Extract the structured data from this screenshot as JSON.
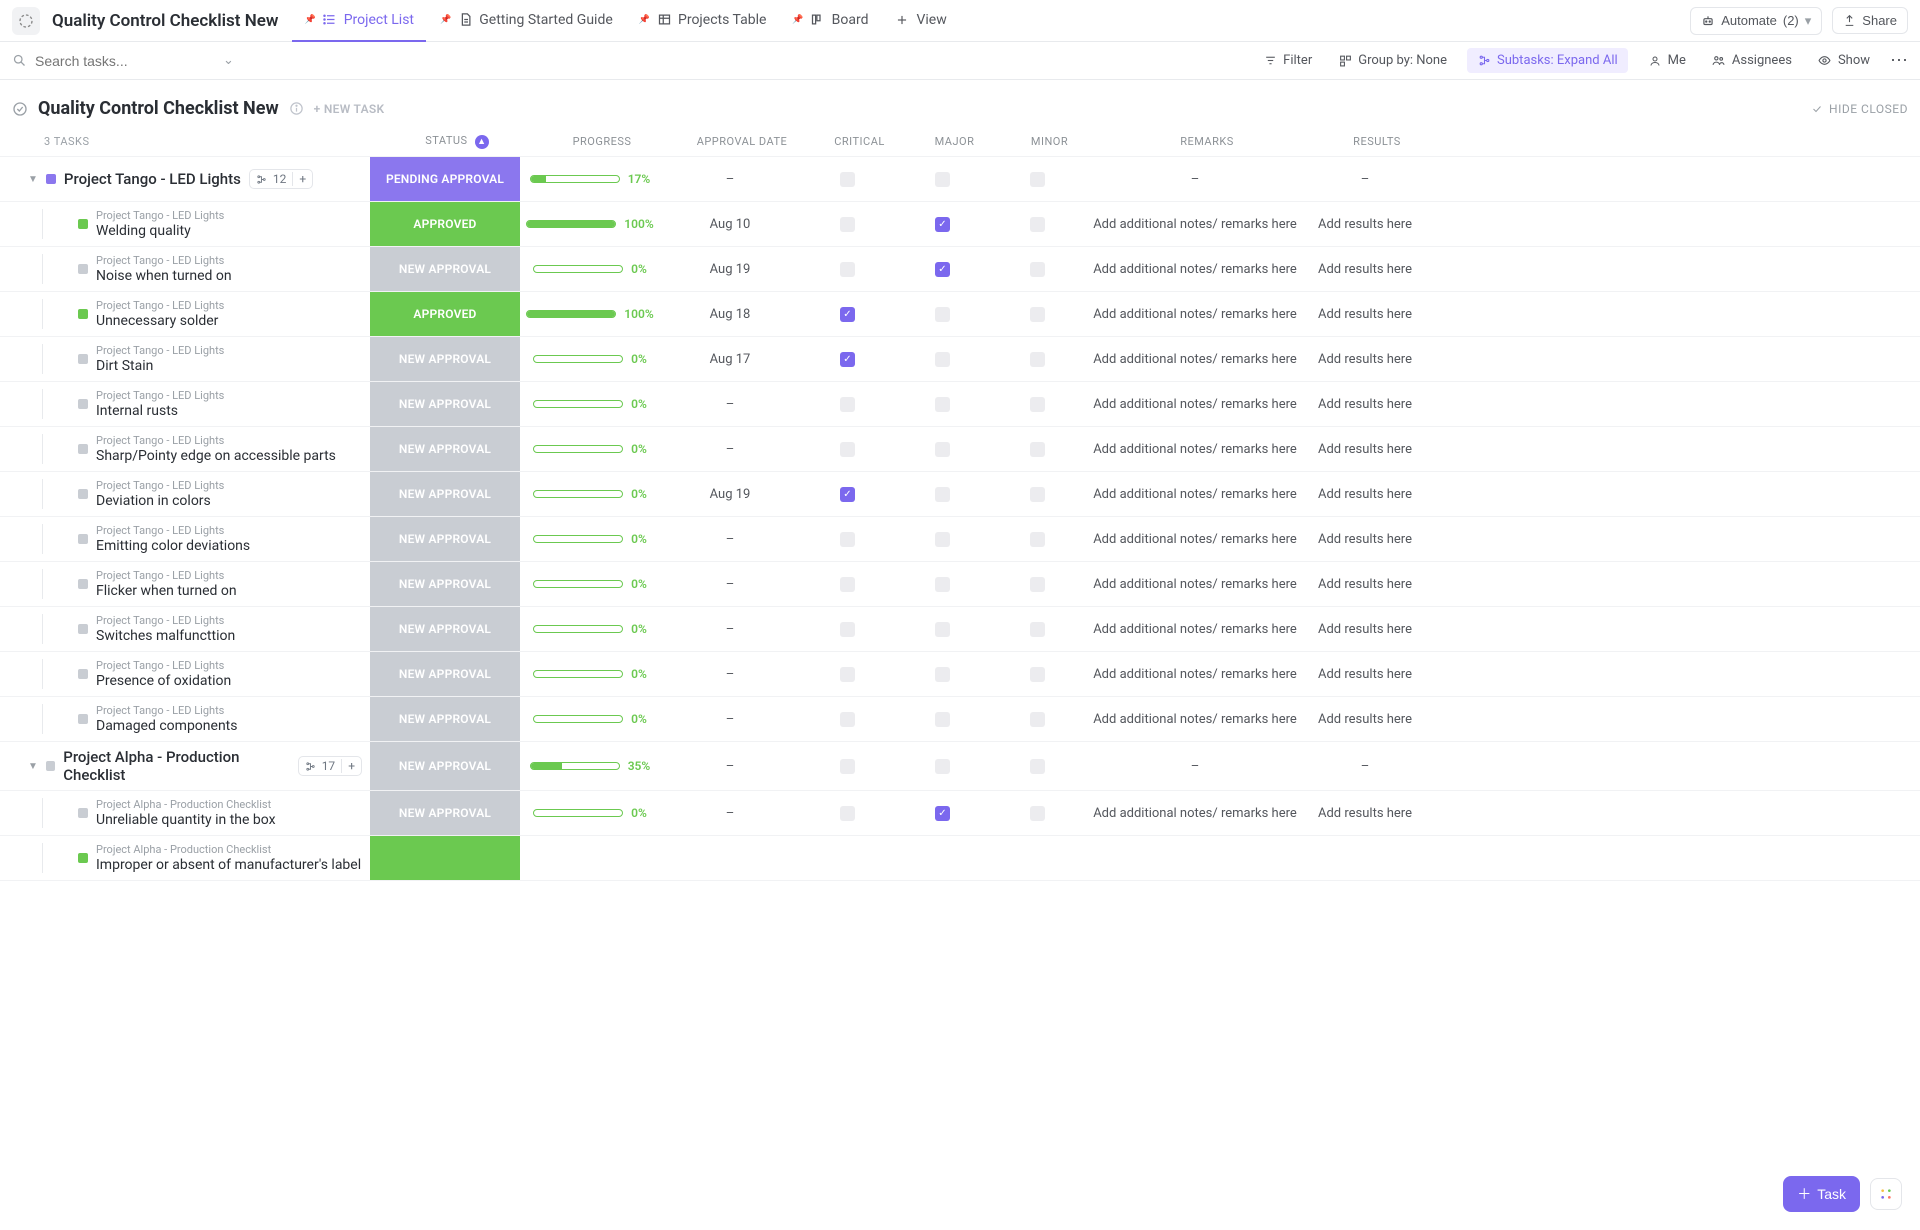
{
  "header": {
    "title": "Quality Control Checklist New",
    "tabs": [
      {
        "label": "Project List",
        "active": true,
        "icon": "list"
      },
      {
        "label": "Getting Started Guide",
        "active": false,
        "icon": "doc"
      },
      {
        "label": "Projects Table",
        "active": false,
        "icon": "table"
      },
      {
        "label": "Board",
        "active": false,
        "icon": "board"
      },
      {
        "label": "View",
        "active": false,
        "icon": "plus",
        "noPin": true
      }
    ],
    "automate": {
      "label": "Automate",
      "count": "(2)"
    },
    "share": "Share"
  },
  "filterbar": {
    "search_placeholder": "Search tasks...",
    "filter": "Filter",
    "groupby": "Group by: None",
    "subtasks": "Subtasks: Expand All",
    "me": "Me",
    "assignees": "Assignees",
    "show": "Show"
  },
  "section": {
    "title": "Quality Control Checklist New",
    "new_task": "+ NEW TASK",
    "hide_closed": "HIDE CLOSED"
  },
  "columns": {
    "tasks_count": "3 TASKS",
    "status": "STATUS",
    "progress": "PROGRESS",
    "approval_date": "APPROVAL DATE",
    "critical": "CRITICAL",
    "major": "MAJOR",
    "minor": "MINOR",
    "remarks": "REMARKS",
    "results": "RESULTS"
  },
  "defaults": {
    "remarks_placeholder": "Add additional notes/ remarks here",
    "results_placeholder": "Add results here",
    "dash": "–"
  },
  "groups": [
    {
      "name": "Project Tango - LED Lights",
      "count": "12",
      "color": "purple",
      "status": {
        "label": "PENDING APPROVAL",
        "class": "status-pending"
      },
      "progress": 17,
      "date": "–",
      "critical": false,
      "major": false,
      "minor": false,
      "remarks": "–",
      "results": "–",
      "subtasks": [
        {
          "name": "Welding quality",
          "sq": "green",
          "status": {
            "label": "APPROVED",
            "class": "status-approved"
          },
          "progress": 100,
          "date": "Aug 10",
          "critical": false,
          "major": true,
          "minor": false
        },
        {
          "name": "Noise when turned on",
          "sq": "grey",
          "status": {
            "label": "NEW APPROVAL",
            "class": "status-new"
          },
          "progress": 0,
          "date": "Aug 19",
          "critical": false,
          "major": true,
          "minor": false
        },
        {
          "name": "Unnecessary solder",
          "sq": "green",
          "status": {
            "label": "APPROVED",
            "class": "status-approved"
          },
          "progress": 100,
          "date": "Aug 18",
          "critical": true,
          "major": false,
          "minor": false
        },
        {
          "name": "Dirt Stain",
          "sq": "grey",
          "status": {
            "label": "NEW APPROVAL",
            "class": "status-new"
          },
          "progress": 0,
          "date": "Aug 17",
          "critical": true,
          "major": false,
          "minor": false
        },
        {
          "name": "Internal rusts",
          "sq": "grey",
          "status": {
            "label": "NEW APPROVAL",
            "class": "status-new"
          },
          "progress": 0,
          "date": "–",
          "critical": false,
          "major": false,
          "minor": false
        },
        {
          "name": "Sharp/Pointy edge on accessible parts",
          "sq": "grey",
          "status": {
            "label": "NEW APPROVAL",
            "class": "status-new"
          },
          "progress": 0,
          "date": "–",
          "critical": false,
          "major": false,
          "minor": false
        },
        {
          "name": "Deviation in colors",
          "sq": "grey",
          "status": {
            "label": "NEW APPROVAL",
            "class": "status-new"
          },
          "progress": 0,
          "date": "Aug 19",
          "critical": true,
          "major": false,
          "minor": false
        },
        {
          "name": "Emitting color deviations",
          "sq": "grey",
          "status": {
            "label": "NEW APPROVAL",
            "class": "status-new"
          },
          "progress": 0,
          "date": "–",
          "critical": false,
          "major": false,
          "minor": false
        },
        {
          "name": "Flicker when turned on",
          "sq": "grey",
          "status": {
            "label": "NEW APPROVAL",
            "class": "status-new"
          },
          "progress": 0,
          "date": "–",
          "critical": false,
          "major": false,
          "minor": false
        },
        {
          "name": "Switches malfuncttion",
          "sq": "grey",
          "status": {
            "label": "NEW APPROVAL",
            "class": "status-new"
          },
          "progress": 0,
          "date": "–",
          "critical": false,
          "major": false,
          "minor": false
        },
        {
          "name": "Presence of oxidation",
          "sq": "grey",
          "status": {
            "label": "NEW APPROVAL",
            "class": "status-new"
          },
          "progress": 0,
          "date": "–",
          "critical": false,
          "major": false,
          "minor": false
        },
        {
          "name": "Damaged components",
          "sq": "grey",
          "status": {
            "label": "NEW APPROVAL",
            "class": "status-new"
          },
          "progress": 0,
          "date": "–",
          "critical": false,
          "major": false,
          "minor": false
        }
      ]
    },
    {
      "name": "Project Alpha - Production Checklist",
      "count": "17",
      "color": "grey",
      "status": {
        "label": "NEW APPROVAL",
        "class": "status-new"
      },
      "progress": 35,
      "date": "–",
      "critical": false,
      "major": false,
      "minor": false,
      "remarks": "–",
      "results": "–",
      "subtasks": [
        {
          "name": "Unreliable quantity in the box",
          "sq": "grey",
          "status": {
            "label": "NEW APPROVAL",
            "class": "status-new"
          },
          "progress": 0,
          "date": "–",
          "critical": false,
          "major": true,
          "minor": false
        },
        {
          "name": "Improper or absent of manufacturer's label",
          "sq": "green",
          "status": {
            "label": "",
            "class": "status-approved"
          },
          "progress": null,
          "date": "",
          "critical": null,
          "major": null,
          "minor": null,
          "truncated": true
        }
      ]
    }
  ],
  "fab": {
    "label": "Task"
  }
}
